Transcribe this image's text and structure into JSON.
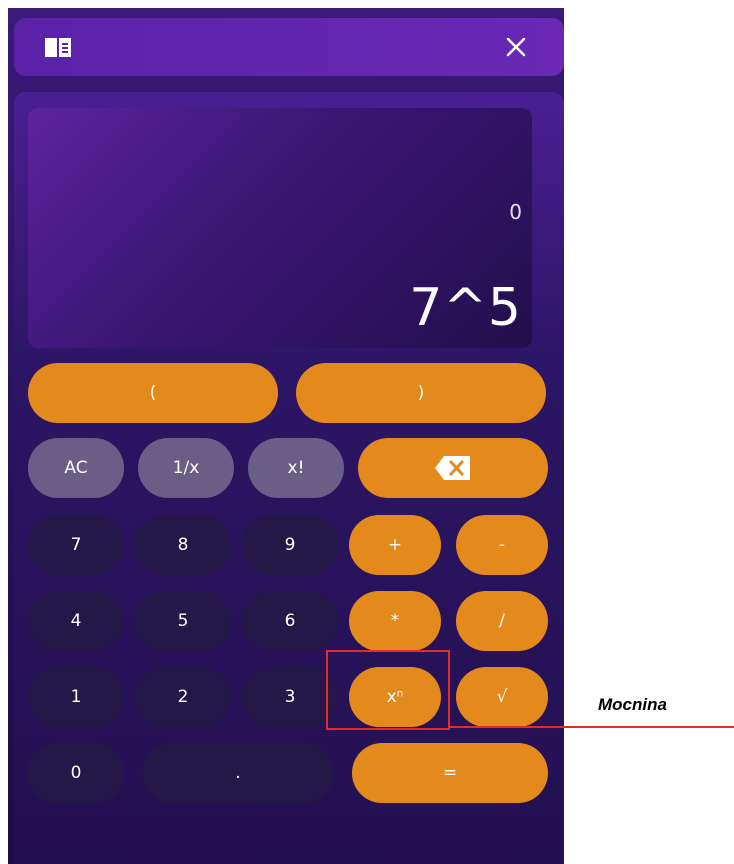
{
  "titlebar": {
    "book_icon": "book-icon",
    "close_icon": "close-icon"
  },
  "display": {
    "previous": "0",
    "current": "7^5"
  },
  "buttons": {
    "paren_open": "(",
    "paren_close": ")",
    "ac": "AC",
    "reciprocal": "1/x",
    "factorial": "x!",
    "backspace_icon": "backspace-icon",
    "seven": "7",
    "eight": "8",
    "nine": "9",
    "plus": "+",
    "minus": "-",
    "four": "4",
    "five": "5",
    "six": "6",
    "multiply": "*",
    "divide": "/",
    "one": "1",
    "two": "2",
    "three": "3",
    "power": "xⁿ",
    "sqrt": "√",
    "zero": "0",
    "decimal": ".",
    "equals": "="
  },
  "annotation": {
    "label": "Mocnina"
  },
  "colors": {
    "accent_orange": "#e4891c",
    "function_gray": "#6a5e86",
    "digit_dark": "#231847",
    "highlight_red": "#e52a2a",
    "background_purple": "#2a1460"
  }
}
